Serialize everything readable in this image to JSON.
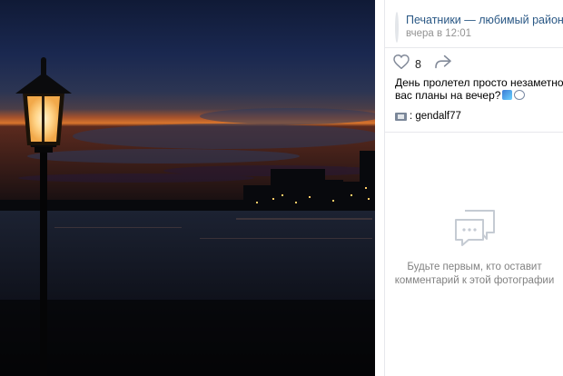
{
  "post": {
    "author_name": "Печатники — любимый район!",
    "time": "вчера в 12:01",
    "likes_count": "8",
    "text_line1": "День пролетел просто незаметно. Какие у",
    "text_line2": "вас планы на вечер?",
    "tagged_user": ": gendalf77"
  },
  "comments": {
    "empty_line1": "Будьте первым, кто оставит",
    "empty_line2": "комментарий к этой фотографии"
  },
  "icons": {
    "like": "heart-icon",
    "share": "share-arrow-icon",
    "comments": "speech-bubble-icon",
    "avatar": "community-avatar"
  },
  "colors": {
    "link": "#2a5885",
    "muted": "#939393"
  }
}
